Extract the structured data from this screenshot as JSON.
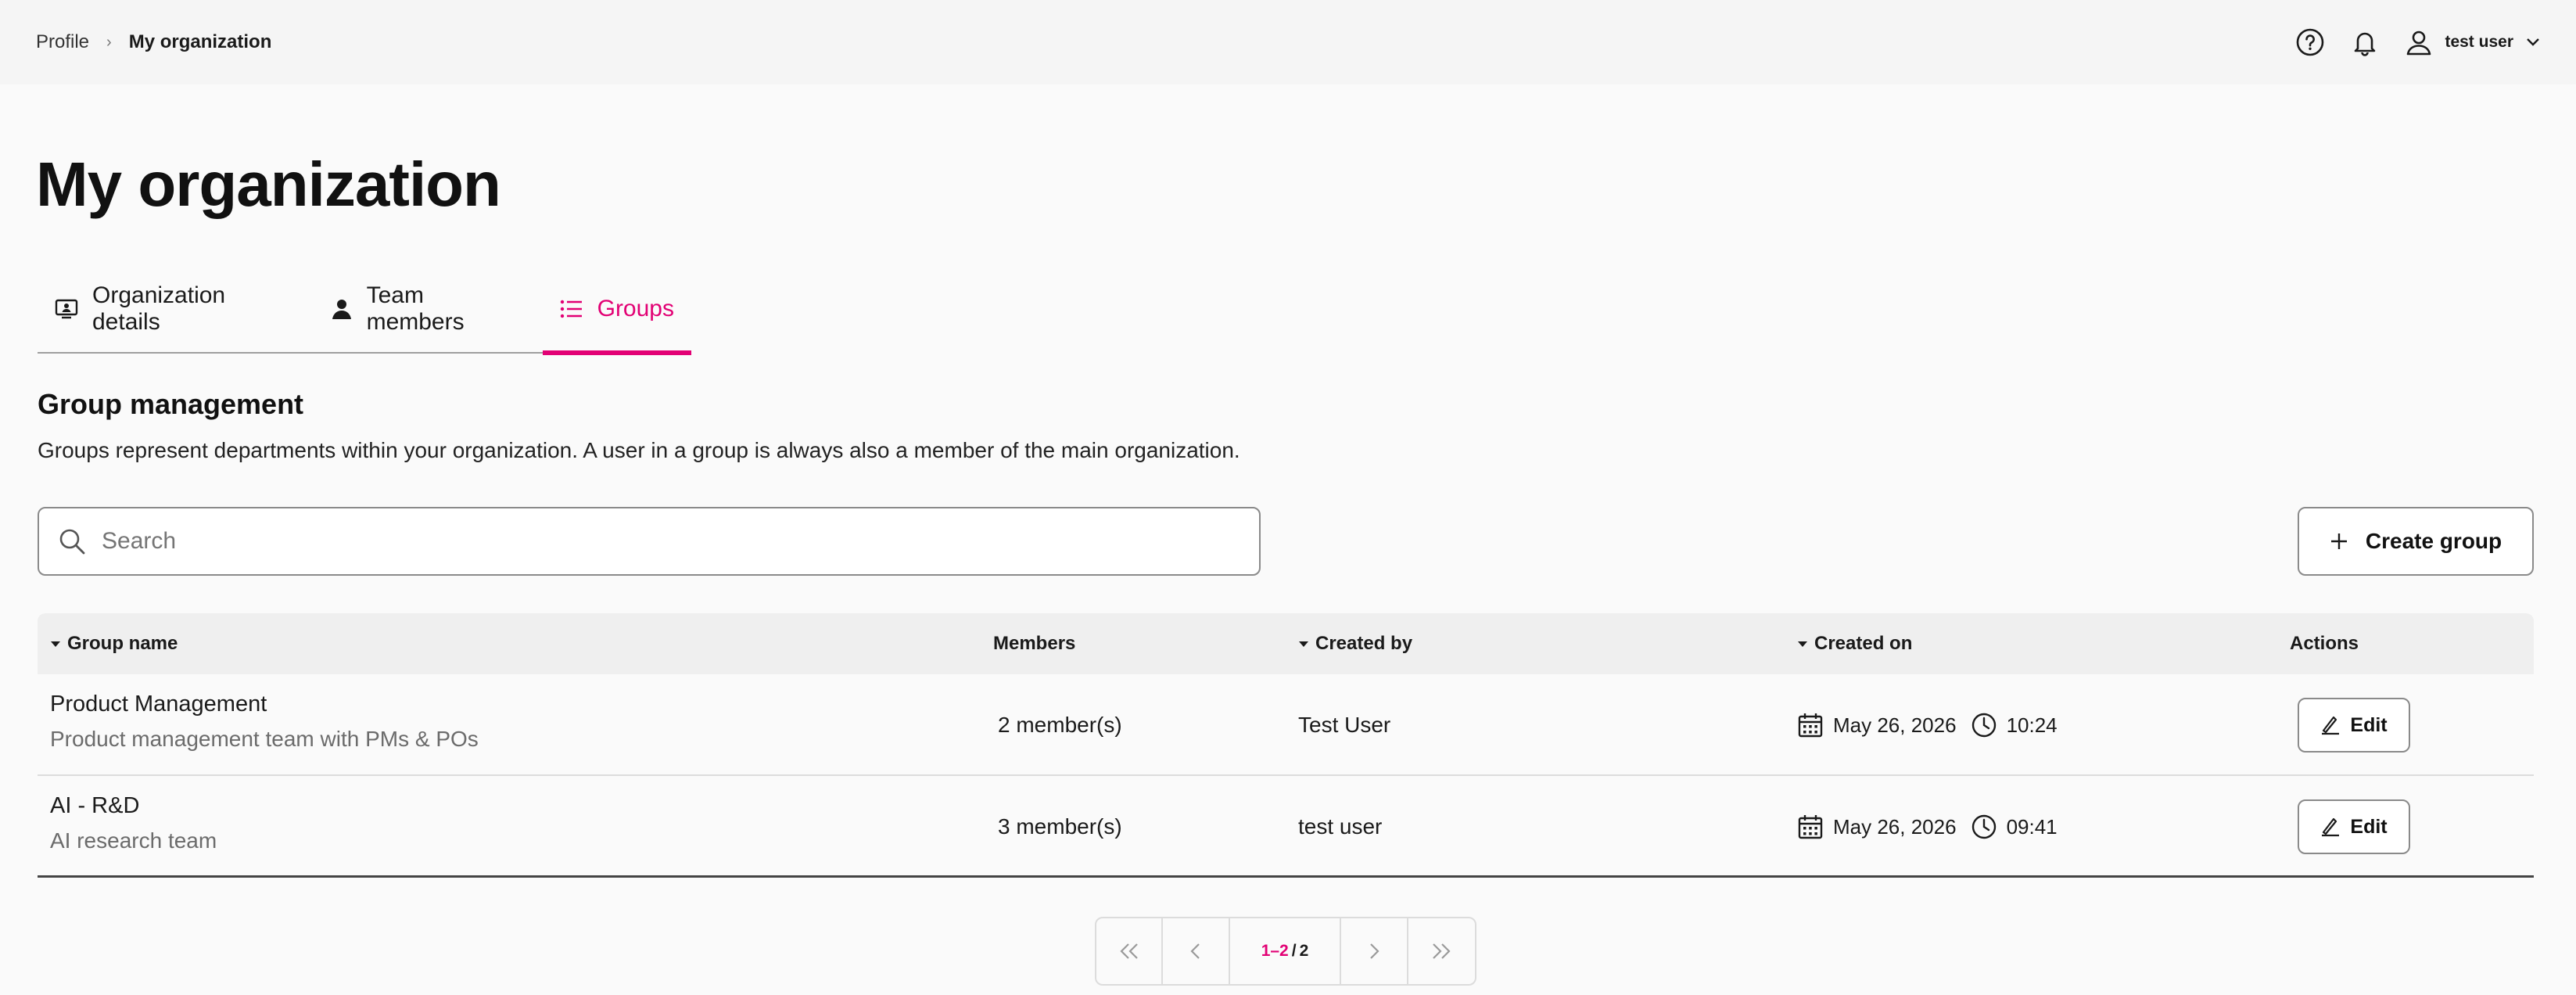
{
  "breadcrumb": {
    "items": [
      "Profile"
    ],
    "separator": "›",
    "current": "My organization"
  },
  "header": {
    "icons": [
      "help-icon",
      "bell-icon",
      "user-icon"
    ],
    "user_name": "test user"
  },
  "page": {
    "title": "My organization"
  },
  "tabs": [
    {
      "label": "Organization details",
      "icon": "organization-icon",
      "active": false
    },
    {
      "label": "Team members",
      "icon": "person-icon",
      "active": false
    },
    {
      "label": "Groups",
      "icon": "list-icon",
      "active": true
    }
  ],
  "section": {
    "title": "Group management",
    "description": "Groups represent departments within your organization. A user in a group is always also a member of the main organization."
  },
  "search": {
    "placeholder": "Search",
    "value": ""
  },
  "create_button": {
    "label": "Create group"
  },
  "table": {
    "columns": [
      "Group name",
      "Members",
      "Created by",
      "Created on",
      "Actions"
    ],
    "rows": [
      {
        "name": "Product Management",
        "description": "Product management team with PMs & POs",
        "members": "2 member(s)",
        "created_by": "Test User",
        "date": "May 26, 2026",
        "time": "10:24",
        "action": "Edit"
      },
      {
        "name": "AI - R&D",
        "description": "AI research team",
        "members": "3 member(s)",
        "created_by": "test user",
        "date": "May 26, 2026",
        "time": "09:41",
        "action": "Edit"
      }
    ]
  },
  "pagination": {
    "range": "1–2",
    "separator": "/",
    "total": "2"
  },
  "colors": {
    "accent": "#e20074",
    "background": "#fafafa",
    "topbar": "#f5f5f5",
    "table_header": "#efefef"
  }
}
